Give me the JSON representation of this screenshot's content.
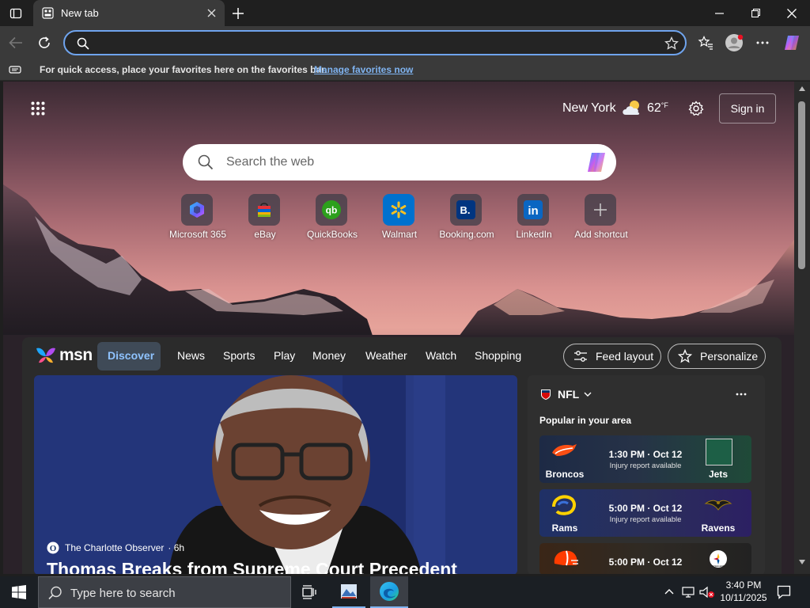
{
  "browser": {
    "tab_title": "New tab",
    "address_value": "",
    "favorites_bar": {
      "message": "For quick access, place your favorites here on the favorites bar.",
      "link": "Manage favorites now"
    }
  },
  "newtab": {
    "weather": {
      "city": "New York",
      "temp": "62",
      "unit": "°F"
    },
    "sign_in": "Sign in",
    "search_placeholder": "Search the web",
    "shortcuts": [
      {
        "label": "Microsoft 365",
        "icon": "microsoft365-icon",
        "color": "#6a5cff"
      },
      {
        "label": "eBay",
        "icon": "ebay-bag-icon",
        "color": "#e53238"
      },
      {
        "label": "QuickBooks",
        "icon": "quickbooks-icon",
        "color": "#2ca01c"
      },
      {
        "label": "Walmart",
        "icon": "walmart-spark-icon",
        "color": "#ffc220"
      },
      {
        "label": "Booking.com",
        "icon": "booking-icon",
        "color": "#003580"
      },
      {
        "label": "LinkedIn",
        "icon": "linkedin-icon",
        "color": "#0a66c2"
      },
      {
        "label": "Add shortcut",
        "icon": "plus-icon",
        "color": "#cccccc"
      }
    ]
  },
  "feed": {
    "brand": "msn",
    "nav": [
      "Discover",
      "News",
      "Sports",
      "Play",
      "Money",
      "Weather",
      "Watch",
      "Shopping"
    ],
    "active_nav": "Discover",
    "feed_layout": "Feed layout",
    "personalize": "Personalize",
    "hero": {
      "source": "The Charlotte Observer",
      "age": "· 6h",
      "title": "Thomas Breaks from Supreme Court Precedent"
    },
    "nfl": {
      "league": "NFL",
      "subtitle": "Popular in your area",
      "games": [
        {
          "home": "Broncos",
          "away": "Jets",
          "time": "1:30 PM · Oct 12",
          "note": "Injury report available"
        },
        {
          "home": "Rams",
          "away": "Ravens",
          "time": "5:00 PM · Oct 12",
          "note": "Injury report available"
        },
        {
          "home": "Browns",
          "away": "Steelers",
          "time": "5:00 PM · Oct 12",
          "note": ""
        }
      ]
    }
  },
  "taskbar": {
    "search_placeholder": "Type here to search",
    "time": "3:40 PM",
    "date": "10/11/2025"
  }
}
